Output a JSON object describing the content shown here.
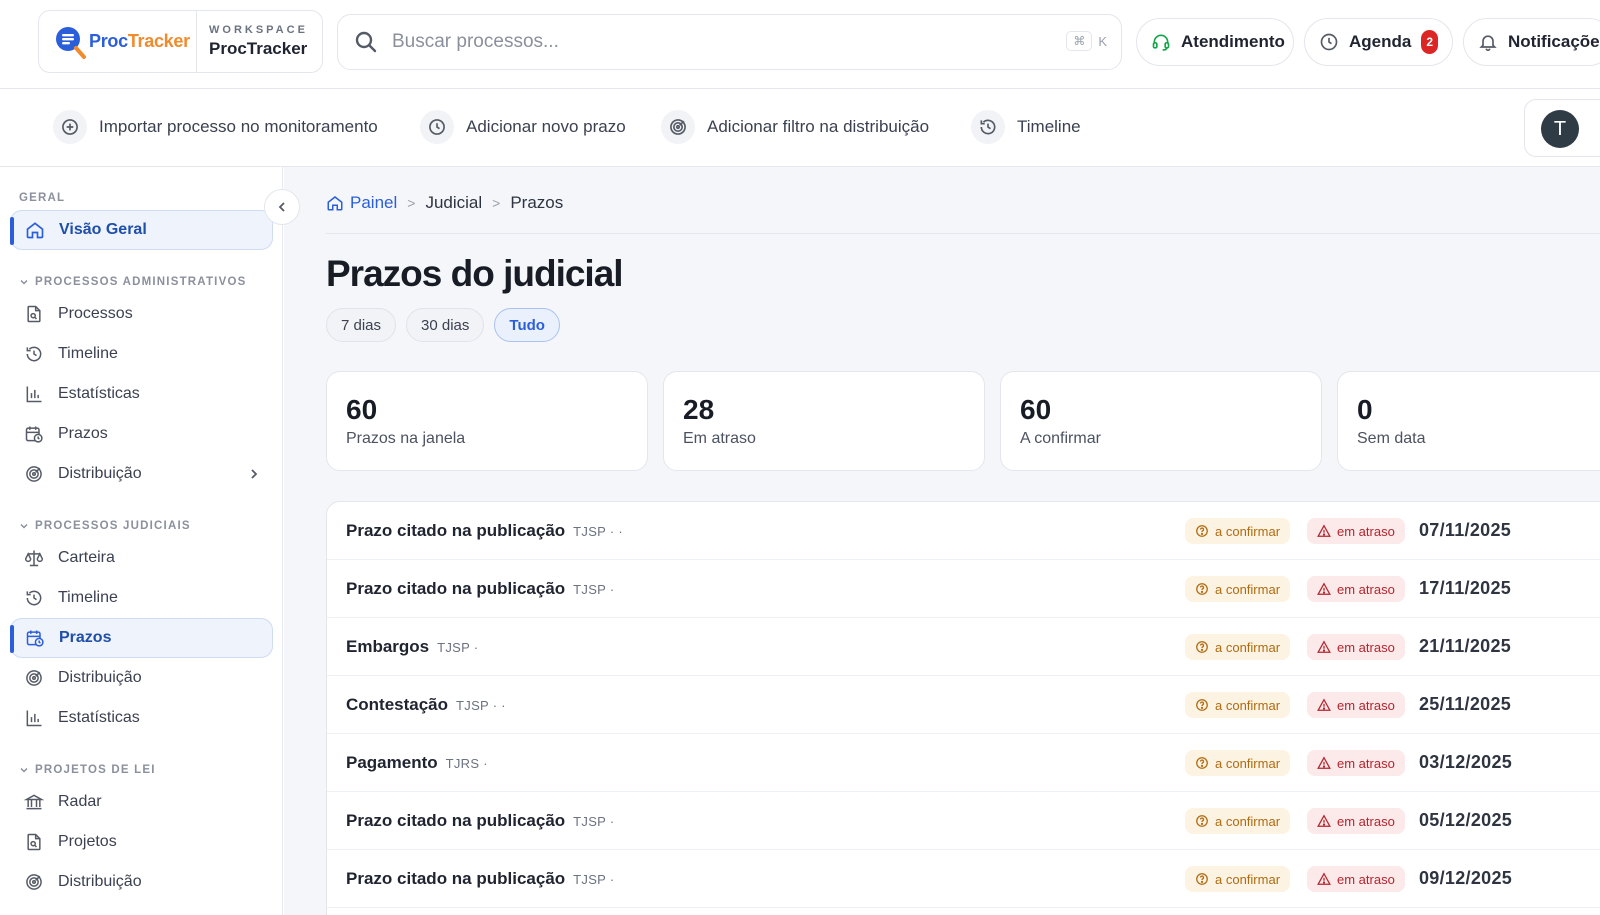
{
  "workspace": {
    "logo_part1": "Proc",
    "logo_part2": "Tracker",
    "label": "WORKSPACE",
    "name": "ProcTracker"
  },
  "search": {
    "placeholder": "Buscar processos...",
    "shortcut_symbol": "⌘",
    "shortcut_key": "K"
  },
  "top_buttons": {
    "atendimento": "Atendimento",
    "agenda": "Agenda",
    "agenda_count": "2",
    "notificacoes": "Notificações"
  },
  "actions": [
    {
      "label": "Importar processo no monitoramento",
      "icon": "plus-circle-icon"
    },
    {
      "label": "Adicionar novo prazo",
      "icon": "clock-icon"
    },
    {
      "label": "Adicionar filtro na distribuição",
      "icon": "target-icon"
    },
    {
      "label": "Timeline",
      "icon": "history-icon"
    }
  ],
  "user": {
    "initial": "T"
  },
  "sidebar": {
    "geral_label": "GERAL",
    "visao_geral": "Visão Geral",
    "admin_label": "PROCESSOS ADMINISTRATIVOS",
    "admin_items": [
      "Processos",
      "Timeline",
      "Estatísticas",
      "Prazos",
      "Distribuição"
    ],
    "judicial_label": "PROCESSOS JUDICIAIS",
    "judicial_items": [
      "Carteira",
      "Timeline",
      "Prazos",
      "Distribuição",
      "Estatísticas"
    ],
    "lei_label": "PROJETOS DE LEI",
    "lei_items": [
      "Radar",
      "Projetos",
      "Distribuição"
    ]
  },
  "breadcrumb": {
    "home": "Painel",
    "level2": "Judicial",
    "level3": "Prazos",
    "separator": ">"
  },
  "page": {
    "title": "Prazos do judicial"
  },
  "filters": [
    "7 dias",
    "30 dias",
    "Tudo"
  ],
  "filters_active": "Tudo",
  "stats": [
    {
      "value": "60",
      "label": "Prazos na janela"
    },
    {
      "value": "28",
      "label": "Em atraso"
    },
    {
      "value": "60",
      "label": "A confirmar"
    },
    {
      "value": "0",
      "label": "Sem data"
    }
  ],
  "deadlines": [
    {
      "title": "Prazo citado na publicação",
      "court": "TJSP · ·",
      "confirm": "a confirmar",
      "status": "em atraso",
      "date": "07/11/2025"
    },
    {
      "title": "Prazo citado na publicação",
      "court": "TJSP ·",
      "confirm": "a confirmar",
      "status": "em atraso",
      "date": "17/11/2025"
    },
    {
      "title": "Embargos",
      "court": "TJSP ·",
      "confirm": "a confirmar",
      "status": "em atraso",
      "date": "21/11/2025"
    },
    {
      "title": "Contestação",
      "court": "TJSP · ·",
      "confirm": "a confirmar",
      "status": "em atraso",
      "date": "25/11/2025"
    },
    {
      "title": "Pagamento",
      "court": "TJRS ·",
      "confirm": "a confirmar",
      "status": "em atraso",
      "date": "03/12/2025"
    },
    {
      "title": "Prazo citado na publicação",
      "court": "TJSP ·",
      "confirm": "a confirmar",
      "status": "em atraso",
      "date": "05/12/2025"
    },
    {
      "title": "Prazo citado na publicação",
      "court": "TJSP ·",
      "confirm": "a confirmar",
      "status": "em atraso",
      "date": "09/12/2025"
    }
  ],
  "colors": {
    "accent": "#2b5fd9",
    "brand_orange": "#f08c2e",
    "late_text": "#b3262f",
    "late_bg": "#fce9ea",
    "confirm_text": "#b06b12",
    "confirm_bg": "#fdf3e2",
    "badge": "#dc2626"
  }
}
